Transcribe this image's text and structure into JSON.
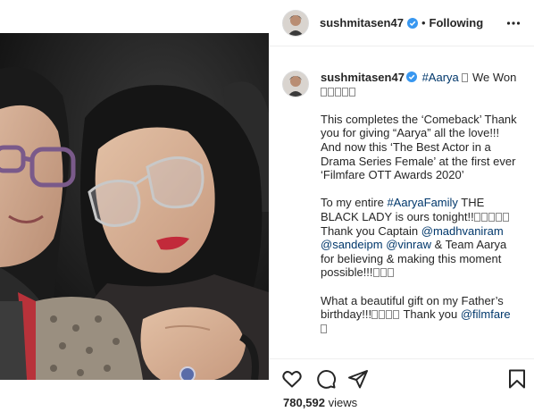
{
  "header": {
    "username": "sushmitasen47",
    "separator": "•",
    "follow_status": "Following"
  },
  "caption": {
    "username": "sushmitasen47",
    "hashtag_title": "#Aarya",
    "title_text": "We Won",
    "p1": "This completes the ‘Comeback’ Thank you for giving “Aarya” all the love!!! And now this ‘The Best Actor in a Drama Series Female’ at the first ever ‘Filmfare OTT Awards 2020’",
    "p2_intro": "To my entire",
    "hashtag_family": "#AaryaFamily",
    "p2_text": "THE BLACK LADY is ours tonight!!",
    "p2_thanks": "Thank you Captain",
    "mention_madhvan": "@madhvaniram",
    "mention_sandeip": "@sandeipm",
    "mention_vinraw": "@vinraw",
    "p2_end": "& Team Aarya for believing & making this moment possible!!!",
    "p3_text": "What a beautiful gift on my Father’s birthday!!!",
    "p3_thanks": "Thank you",
    "mention_filmfare": "@filmfare"
  },
  "actions": {
    "icons": [
      "heart-icon",
      "comment-icon",
      "share-icon",
      "bookmark-icon"
    ]
  },
  "views": {
    "count": "780,592",
    "label": "views"
  },
  "colors": {
    "link": "#00376b",
    "verified": "#3897f0",
    "border": "#efefef"
  }
}
